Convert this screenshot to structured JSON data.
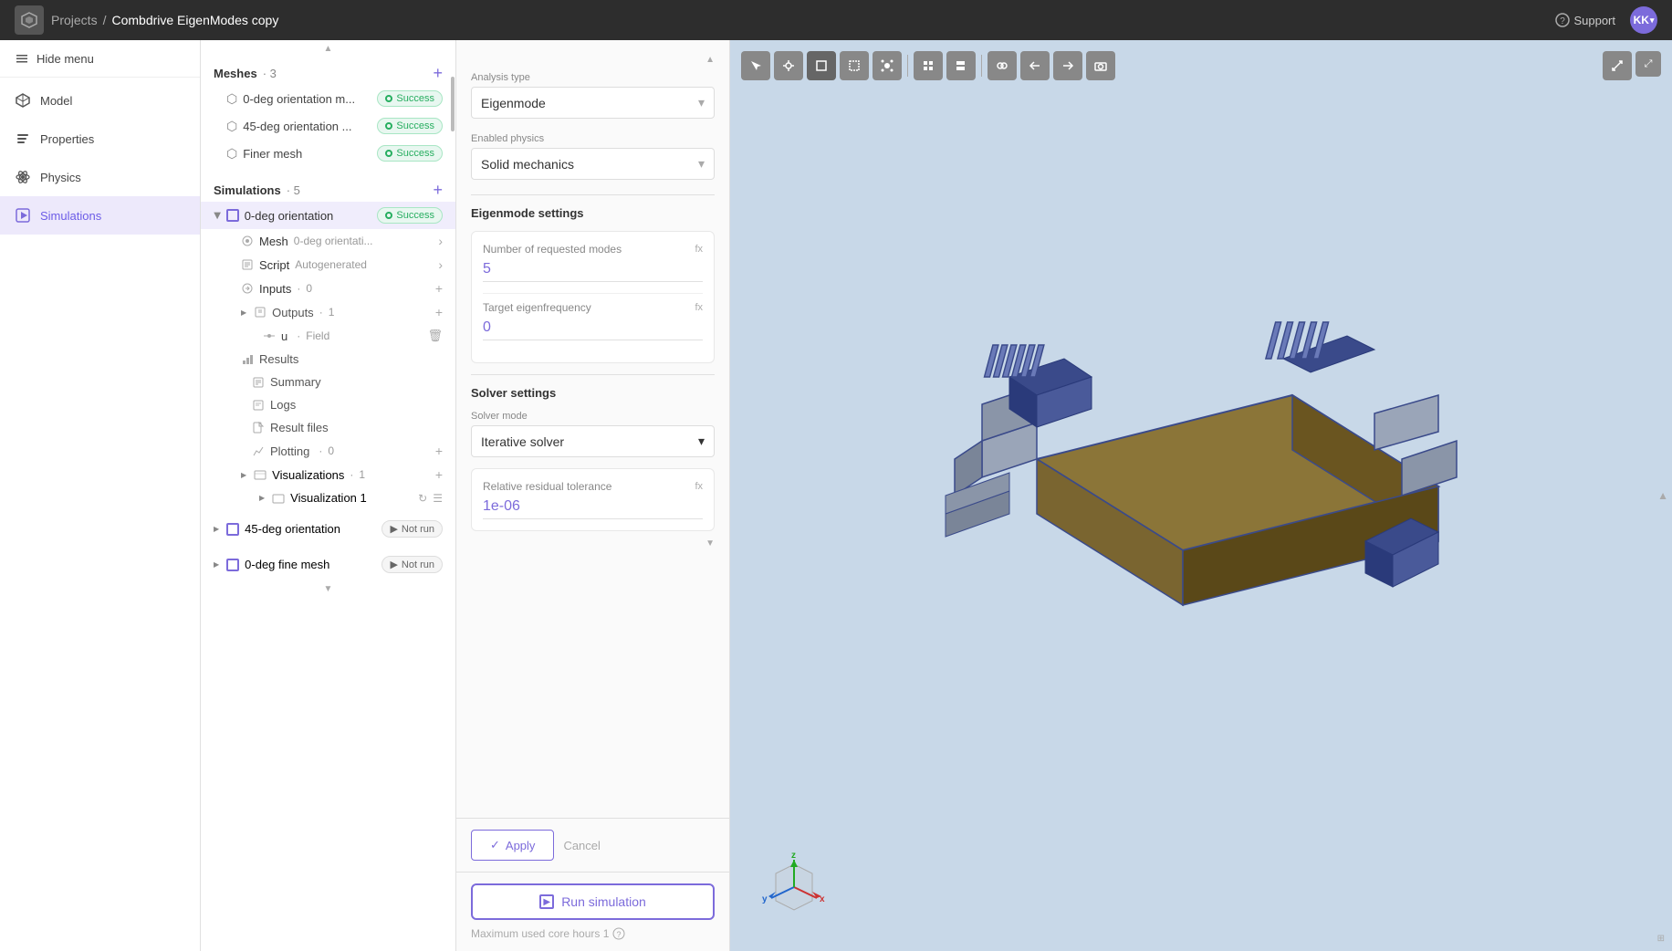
{
  "topbar": {
    "logo": "S",
    "breadcrumb": {
      "projects": "Projects",
      "separator": "/",
      "current": "Combdrive EigenModes copy"
    },
    "support_label": "Support",
    "user_initials": "KK"
  },
  "nav": {
    "hide_menu": "Hide menu",
    "items": [
      {
        "id": "model",
        "label": "Model",
        "icon": "cube"
      },
      {
        "id": "properties",
        "label": "Properties",
        "icon": "list"
      },
      {
        "id": "physics",
        "label": "Physics",
        "icon": "atom"
      },
      {
        "id": "simulations",
        "label": "Simulations",
        "icon": "play-box",
        "active": true
      }
    ]
  },
  "tree": {
    "meshes_label": "Meshes",
    "meshes_count": "3",
    "simulations_label": "Simulations",
    "simulations_count": "5",
    "meshes": [
      {
        "name": "0-deg orientation m...",
        "status": "Success"
      },
      {
        "name": "45-deg orientation ...",
        "status": "Success"
      },
      {
        "name": "Finer mesh",
        "status": "Success"
      }
    ],
    "simulations": [
      {
        "name": "0-deg orientation",
        "status": "Success",
        "active": true,
        "children": {
          "mesh": {
            "label": "Mesh",
            "value": "0-deg orientati..."
          },
          "script": {
            "label": "Script",
            "value": "Autogenerated"
          },
          "inputs": {
            "label": "Inputs",
            "count": "0"
          },
          "outputs": {
            "label": "Outputs",
            "count": "1"
          },
          "u_field": {
            "label": "u",
            "type": "Field"
          },
          "results": {
            "label": "Results",
            "items": [
              "Summary",
              "Logs",
              "Result files"
            ]
          },
          "plotting": {
            "label": "Plotting",
            "count": "0"
          },
          "visualizations": {
            "label": "Visualizations",
            "count": "1"
          },
          "visualization1": {
            "label": "Visualization 1"
          }
        }
      },
      {
        "name": "45-deg orientation",
        "status": "Not run"
      },
      {
        "name": "0-deg fine mesh",
        "status": "Not run"
      }
    ]
  },
  "config": {
    "analysis_type_label": "Analysis type",
    "analysis_type": "Eigenmode",
    "enabled_physics_label": "Enabled physics",
    "enabled_physics": "Solid mechanics",
    "eigenmode_settings_label": "Eigenmode settings",
    "num_modes_label": "Number of requested modes",
    "num_modes_value": "5",
    "target_freq_label": "Target eigenfrequency",
    "target_freq_value": "0",
    "solver_settings_label": "Solver settings",
    "solver_mode_label": "Solver mode",
    "solver_mode": "Iterative solver",
    "tolerance_label": "Relative residual tolerance",
    "tolerance_value": "1e-06",
    "apply_label": "Apply",
    "cancel_label": "Cancel",
    "run_label": "Run simulation",
    "core_hours_label": "Maximum used core hours",
    "core_hours_value": "1"
  },
  "viewport": {
    "toolbar_buttons": [
      "cursor",
      "pan",
      "box",
      "rectangle",
      "node",
      "grid4",
      "grid2",
      "chain",
      "back",
      "forward",
      "camera"
    ],
    "axis": {
      "x": "x",
      "y": "y",
      "z": "z"
    }
  }
}
